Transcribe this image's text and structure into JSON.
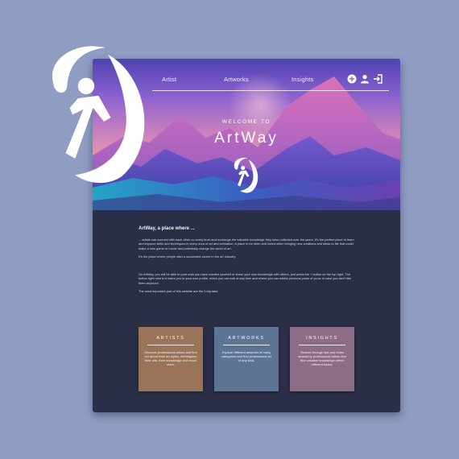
{
  "nav": {
    "links": [
      "Artist",
      "Artworks",
      "Insights"
    ],
    "icons": [
      "add-icon",
      "user-icon",
      "logout-icon"
    ]
  },
  "hero": {
    "welcome": "WELCOME TO",
    "brand": "ArtWay"
  },
  "content": {
    "tagline": "ArtWay, a place where ...",
    "paragraphs": [
      "... artists can connect with each other on every level and exchange the valuable knowledge they have collected over the years. It's the perfect place to learn and improve skills and techniques in every area of art and animation. A place to be seen and heard when bringing new creations and ideas to life that could make a new game or movie and potentially change the world of art.",
      "It's the place where people start a successful career in the art industry.",
      "On ArtWay, you will be able to post work you have created yourself or share your own knowledge with others, just press the + button on the top right. The button right next to it takes you to your own profile, which you can edit at any time and where you can delete previous posts of yours in case you don't like them anymore.",
      "The most important part of this website are the 3 big tabs:"
    ]
  },
  "cards": [
    {
      "title": "ARTISTS",
      "desc": "Discover professional artists and find out about their art styles, techniques, their site, their knowledge and much more.",
      "color": "#9b7358"
    },
    {
      "title": "ARTWORKS",
      "desc": "Explore different artworks of many categories and find professional art of any kind.",
      "color": "#5d7595"
    },
    {
      "title": "INSIGHTS",
      "desc": "Browse through tips and tricks shared by professional artists and find valuable knowledge within different topics.",
      "color": "#8e6b86"
    }
  ],
  "colors": {
    "page_bg": "#8f9dc3",
    "site_bg": "#2a2f47"
  }
}
